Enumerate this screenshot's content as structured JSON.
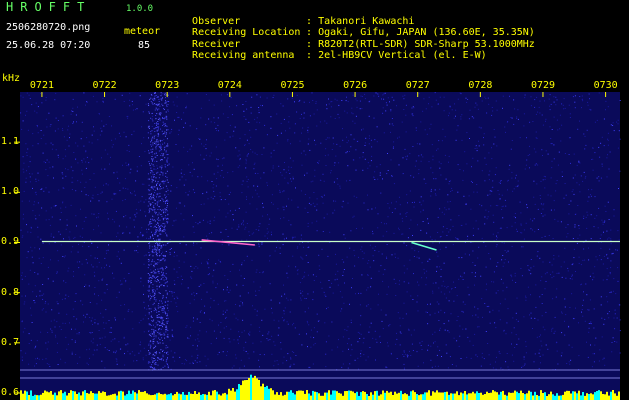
{
  "header": {
    "title": "HROFFT",
    "version": "1.0.0",
    "filename": "2506280720.png",
    "datetime": "25.06.28 07:20",
    "meteor_label": "meteor",
    "meteor_count": "85"
  },
  "info": [
    {
      "label": "Observer",
      "value": ": Takanori Kawachi"
    },
    {
      "label": "Receiving Location",
      "value": ": Ogaki, Gifu, JAPAN (136.60E, 35.35N)"
    },
    {
      "label": "Receiver",
      "value": ": R820T2(RTL-SDR) SDR-Sharp 53.1000MHz"
    },
    {
      "label": "Receiving antenna",
      "value": ": 2el-HB9CV Vertical (el. E-W)"
    }
  ],
  "colors": {
    "background": "#000000",
    "noise": "#1a1aa0",
    "carrier": "#c8ffc8",
    "text_yellow": "#ffff00",
    "text_green": "#66ff66",
    "bottom_bar": "#ffff00",
    "bottom_bar_alt": "#00ffff"
  },
  "chart_data": {
    "type": "heatmap",
    "title": "",
    "ylabel": "kHz",
    "xlabel": "",
    "y_ticks": [
      "1.1",
      "1.0",
      "0.9",
      "0.8",
      "0.7",
      "0.6"
    ],
    "y_values": [
      1.1,
      1.0,
      0.9,
      0.8,
      0.7,
      0.6
    ],
    "ylim": [
      0.59,
      1.2
    ],
    "x_ticks": [
      "0721",
      "0722",
      "0723",
      "0724",
      "0725",
      "0726",
      "0727",
      "0728",
      "0729",
      "0730"
    ],
    "x_values": [
      21,
      22,
      23,
      24,
      25,
      26,
      27,
      28,
      29,
      30
    ],
    "xlim": [
      20.65,
      30.23
    ],
    "carrier": {
      "frequency_khz": 0.902,
      "start_minute": 21.0,
      "end_minute": 30.23
    },
    "noise_column_minute": 22.85,
    "meteor_echoes": [
      {
        "minute_start": 23.55,
        "minute_end": 24.4,
        "freq_start": 0.905,
        "freq_end": 0.895
      },
      {
        "minute_start": 26.9,
        "minute_end": 27.3,
        "freq_start": 0.9,
        "freq_end": 0.885
      }
    ],
    "grid": false
  }
}
